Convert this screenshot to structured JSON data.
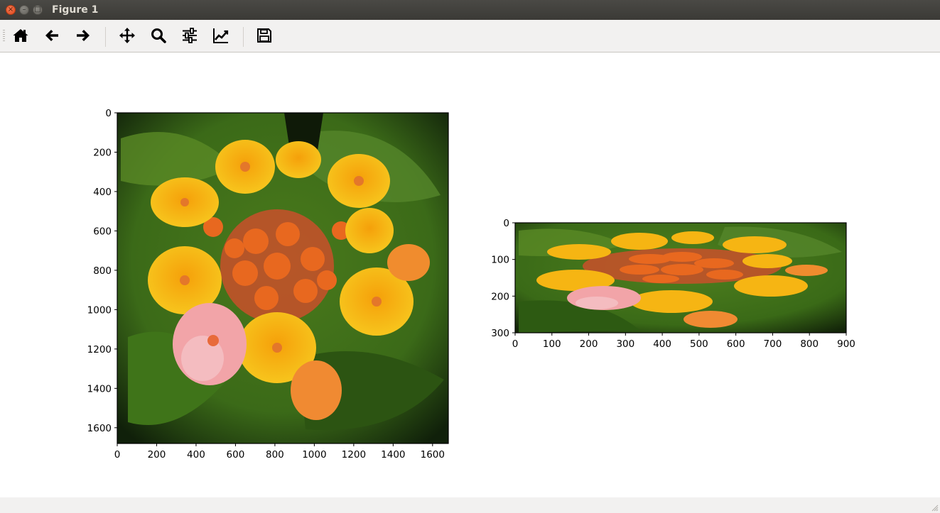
{
  "window": {
    "title": "Figure 1",
    "buttons": {
      "close": "×",
      "minimize": "–",
      "maximize": "□"
    }
  },
  "toolbar": {
    "items": [
      {
        "name": "home-button",
        "icon": "home-icon"
      },
      {
        "name": "back-button",
        "icon": "arrow-left-icon"
      },
      {
        "name": "forward-button",
        "icon": "arrow-right-icon"
      },
      {
        "name": "pan-button",
        "icon": "move-icon"
      },
      {
        "name": "zoom-button",
        "icon": "magnifier-icon"
      },
      {
        "name": "configure-subplots-button",
        "icon": "sliders-icon"
      },
      {
        "name": "edit-axes-button",
        "icon": "line-chart-icon"
      },
      {
        "name": "save-button",
        "icon": "floppy-disk-icon"
      }
    ]
  },
  "chart_data": [
    {
      "type": "image",
      "content": "photo of lantana flower cluster, yellow, orange and pink blossoms on green leaves",
      "xlim": [
        0,
        1680
      ],
      "ylim": [
        1680,
        0
      ],
      "xticks": [
        "0",
        "200",
        "400",
        "600",
        "800",
        "1000",
        "1200",
        "1400",
        "1600"
      ],
      "yticks": [
        "0",
        "200",
        "400",
        "600",
        "800",
        "1000",
        "1200",
        "1400",
        "1600"
      ],
      "title": "",
      "xlabel": "",
      "ylabel": ""
    },
    {
      "type": "image",
      "content": "same flower photo resized (horizontally stretched, vertically squashed)",
      "xlim": [
        0,
        900
      ],
      "ylim": [
        300,
        0
      ],
      "xticks": [
        "0",
        "100",
        "200",
        "300",
        "400",
        "500",
        "600",
        "700",
        "800",
        "900"
      ],
      "yticks": [
        "0",
        "100",
        "200",
        "300"
      ],
      "title": "",
      "xlabel": "",
      "ylabel": ""
    }
  ],
  "colors": {
    "leaf_dark": "#1f3a0c",
    "leaf": "#4a7a1c",
    "petal_yellow": "#f5b70e",
    "petal_orange": "#e8681f",
    "petal_pink": "#f2a4a8"
  }
}
